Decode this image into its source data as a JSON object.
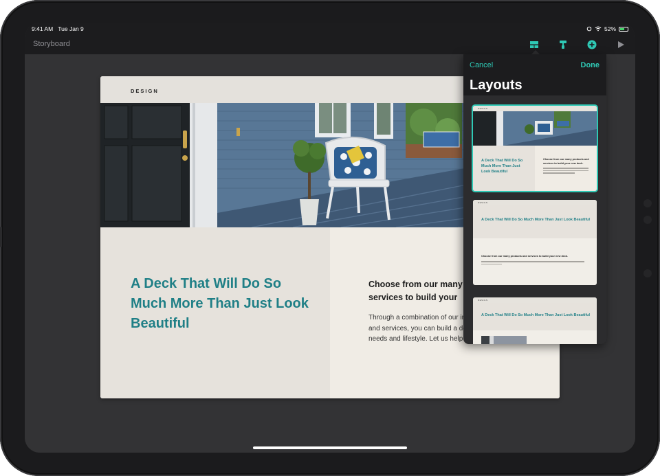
{
  "statusbar": {
    "time": "9:41 AM",
    "date": "Tue Jan 9",
    "battery": "52%",
    "icons": [
      "rotation-lock-icon",
      "wifi-icon",
      "battery-icon"
    ]
  },
  "toolbar": {
    "title": "Storyboard",
    "icons": [
      "layout-icon",
      "format-brush-icon",
      "add-icon",
      "play-icon"
    ],
    "accent_color": "#2fc9b5"
  },
  "slide": {
    "section": "DESIGN",
    "title": "A Deck That Will Do So Much More Than Just Look Beautiful",
    "subtitle": "Choose from our many",
    "subtitle_line2": "services to build your",
    "body_lines": [
      "Through a combination of our in",
      "and services, you can build a dec",
      "needs and lifestyle. Let us help y"
    ],
    "colors": {
      "title": "#1f7f86",
      "left_panel": "#e6e2dc",
      "right_panel": "#f0ece5"
    }
  },
  "popover": {
    "cancel_label": "Cancel",
    "done_label": "Done",
    "title": "Layouts",
    "layouts": [
      {
        "section": "DESIGN",
        "title": "A Deck That Will Do So Much More Than Just Look Beautiful",
        "subtitle": "Choose from our many products and services to build your new deck.",
        "selected": true
      },
      {
        "section": "DESIGN",
        "title": "A Deck That Will Do So Much More Than Just Look Beautiful",
        "subtitle": "Choose from our many products and services to build your new deck.",
        "selected": false
      },
      {
        "section": "DESIGN",
        "title": "A Deck That Will Do So Much More Than Just Look Beautiful",
        "selected": false
      }
    ]
  }
}
